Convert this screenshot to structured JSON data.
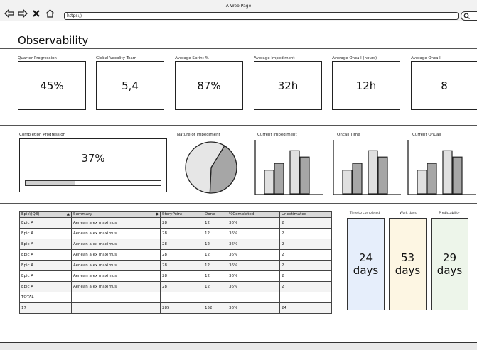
{
  "browser": {
    "title": "A Web Page",
    "url": "https://"
  },
  "page": {
    "title": "Observability"
  },
  "kpis": [
    {
      "label": "Quarter Progression",
      "value": "45%"
    },
    {
      "label": "Global Vecolity Team",
      "value": "5,4"
    },
    {
      "label": "Average Sprint %",
      "value": "87%"
    },
    {
      "label": "Average Impediment",
      "value": "32h"
    },
    {
      "label": "Average Oncall (hours)",
      "value": "12h"
    },
    {
      "label": "Average Oncall",
      "value": "8"
    }
  ],
  "charts": {
    "completion": {
      "label": "Completion Progression",
      "value": "37%",
      "fraction": 0.37
    },
    "impediment_nature": {
      "label": "Nature of Impediment",
      "slices": [
        0.42,
        0.58
      ],
      "colors": [
        "#a6a6a6",
        "#e6e6e6"
      ]
    },
    "current_impediment": {
      "label": "Current Impediment",
      "bars": [
        0.45,
        0.58,
        0.82,
        0.7
      ]
    },
    "oncall_time": {
      "label": "Oncall Time",
      "bars": [
        0.45,
        0.58,
        0.82,
        0.7
      ]
    },
    "current_oncall": {
      "label": "Current OnCall",
      "bars": [
        0.45,
        0.58,
        0.82,
        0.7
      ]
    },
    "bar_colors": [
      "#e0e0e0",
      "#a6a6a6",
      "#e0e0e0",
      "#a6a6a6"
    ]
  },
  "table": {
    "headers": [
      "Epic\\(Q3)",
      "Summary",
      "StoryPoint",
      "Done",
      "%Completed",
      "Unestimated"
    ],
    "rows": [
      [
        "Epic A",
        "Aenean a ex maximus",
        "28",
        "12",
        "36%",
        "2"
      ],
      [
        "Epic A",
        "Aenean a ex maximus",
        "28",
        "12",
        "36%",
        "2"
      ],
      [
        "Epic A",
        "Aenean a ex maximus",
        "28",
        "12",
        "36%",
        "2"
      ],
      [
        "Epic A",
        "Aenean a ex maximus",
        "28",
        "12",
        "36%",
        "2"
      ],
      [
        "Epic A",
        "Aenean a ex maximus",
        "28",
        "12",
        "36%",
        "2"
      ],
      [
        "Epic A",
        "Aenean a ex maximus",
        "28",
        "12",
        "36%",
        "2"
      ],
      [
        "Epic A",
        "Aenean a ex maximus",
        "28",
        "12",
        "36%",
        "2"
      ],
      [
        "TOTAL",
        "",
        "",
        "",
        "",
        ""
      ],
      [
        "17",
        "",
        "285",
        "152",
        "36%",
        "24"
      ]
    ]
  },
  "summary": [
    {
      "label": "Time to completed",
      "value": "24",
      "unit": "days",
      "color": "#e6eefb"
    },
    {
      "label": "Work days",
      "value": "53",
      "unit": "days",
      "color": "#fdf6e3"
    },
    {
      "label": "Predictability",
      "value": "29",
      "unit": "days",
      "color": "#edf5ea"
    }
  ]
}
